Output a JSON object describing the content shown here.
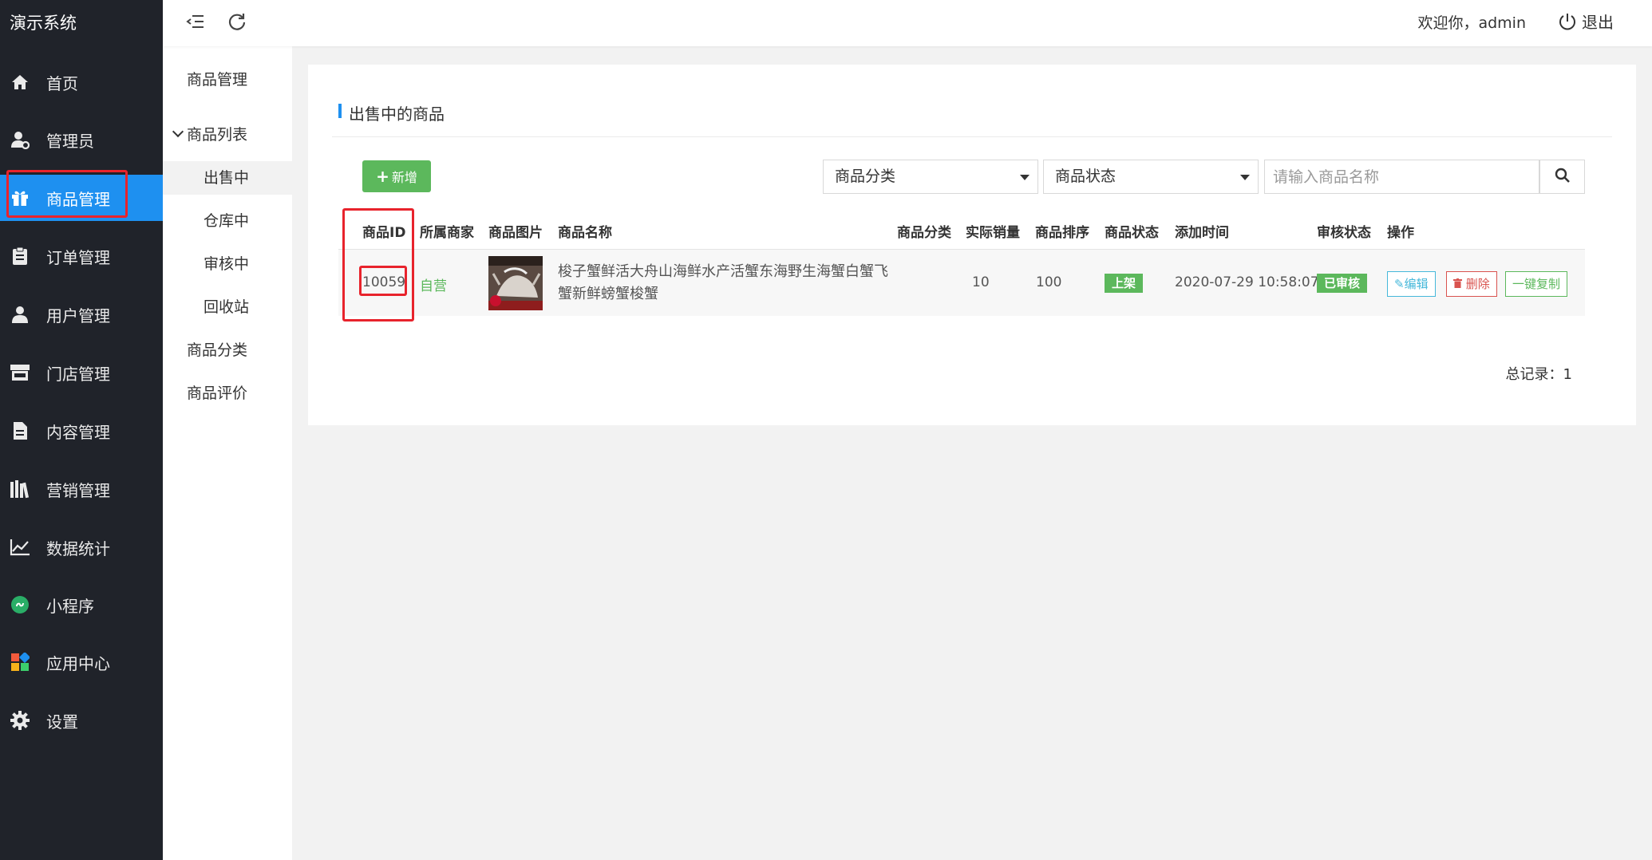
{
  "app": {
    "title": "演示系统"
  },
  "nav": {
    "items": [
      {
        "label": "首页",
        "icon": "home-icon"
      },
      {
        "label": "管理员",
        "icon": "admin-user-icon"
      },
      {
        "label": "商品管理",
        "icon": "gift-icon",
        "active": true
      },
      {
        "label": "订单管理",
        "icon": "clipboard-icon"
      },
      {
        "label": "用户管理",
        "icon": "user-icon"
      },
      {
        "label": "门店管理",
        "icon": "store-icon"
      },
      {
        "label": "内容管理",
        "icon": "document-icon"
      },
      {
        "label": "营销管理",
        "icon": "books-icon"
      },
      {
        "label": "数据统计",
        "icon": "line-chart-icon"
      },
      {
        "label": "小程序",
        "icon": "mini-program-icon"
      },
      {
        "label": "应用中心",
        "icon": "apps-grid-icon"
      },
      {
        "label": "设置",
        "icon": "gear-icon"
      }
    ]
  },
  "submenu": {
    "title": "商品管理",
    "group": "商品列表",
    "children": [
      "出售中",
      "仓库中",
      "审核中",
      "回收站"
    ],
    "active_child": "出售中",
    "others": [
      "商品分类",
      "商品评价"
    ]
  },
  "topbar": {
    "welcome": "欢迎你，admin",
    "logout": "退出"
  },
  "panel": {
    "title": "出售中的商品",
    "add_button": "新增",
    "category_select": "商品分类",
    "status_select": "商品状态",
    "search_placeholder": "请输入商品名称"
  },
  "table": {
    "columns": [
      "商品ID",
      "所属商家",
      "商品图片",
      "商品名称",
      "商品分类",
      "实际销量",
      "商品排序",
      "商品状态",
      "添加时间",
      "审核状态",
      "操作"
    ],
    "rows": [
      {
        "id": "10059",
        "merchant": "自营",
        "name": "梭子蟹鲜活大舟山海鲜水产活蟹东海野生海蟹白蟹飞蟹新鲜螃蟹梭蟹",
        "category": "",
        "sales": "10",
        "sort": "100",
        "status": "上架",
        "added": "2020-07-29 10:58:07",
        "review": "已审核",
        "actions": {
          "edit": "编辑",
          "delete": "删除",
          "copy": "一键复制"
        }
      }
    ]
  },
  "footer": {
    "total": "总记录：1"
  },
  "colors": {
    "sidebar_bg": "#20232a",
    "accent_blue": "#1e90f0",
    "success_green": "#5cb85c",
    "danger_red": "#d9534f",
    "info_cyan": "#46b8da",
    "highlight_red": "#e8232c"
  }
}
